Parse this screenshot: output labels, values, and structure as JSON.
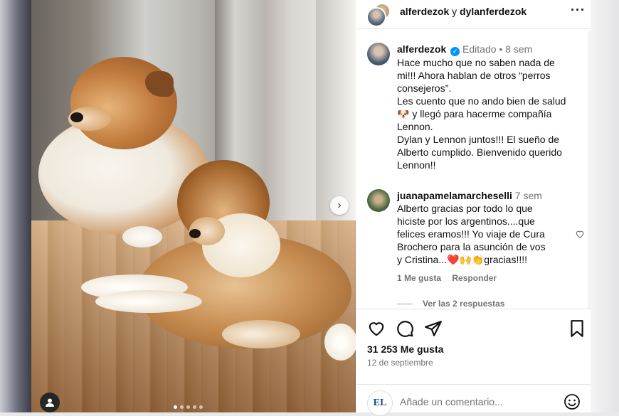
{
  "post": {
    "header": {
      "user1": "alferdezok",
      "separator": "y",
      "user2": "dylanferdezok",
      "more_icon": "more-horizontal-icon"
    },
    "caption": {
      "username": "alferdezok",
      "edited": "Editado",
      "dot": "•",
      "time": "8 sem",
      "lines": [
        "Hace mucho que no saben nada de",
        "mi!!! Ahora hablan de otros “perros",
        "consejeros”.",
        "Les cuento que no ando bien de salud",
        "🐶 y llegó para hacerme compañía",
        "Lennon.",
        "Dylan y Lennon juntos!!! El sueño de",
        "Alberto cumplido. Bienvenido querido",
        "Lennon!!"
      ]
    },
    "comment": {
      "username": "juanapamelamarcheselli",
      "time": "7 sem",
      "lines": [
        "Alberto gracias por todo lo que",
        "hiciste por los argentinos....que",
        "felices eramos!!! Yo viaje de Cura",
        "Brochero para la asunción de vos",
        "y Cristina...❤️🙌👏gracias!!!!"
      ],
      "likes": "1 Me gusta",
      "reply": "Responder",
      "view_replies": "Ver las 2 respuestas"
    },
    "likes_count": "31 253 Me gusta",
    "date": "12 de septiembre",
    "add_comment_placeholder": "Añade un comentario...",
    "watermark": "EL"
  },
  "carousel": {
    "total_slides": 5,
    "active_index": 0
  },
  "colors": {
    "verified": "#0095f6",
    "muted": "#737373",
    "border": "#e5e5e5"
  }
}
